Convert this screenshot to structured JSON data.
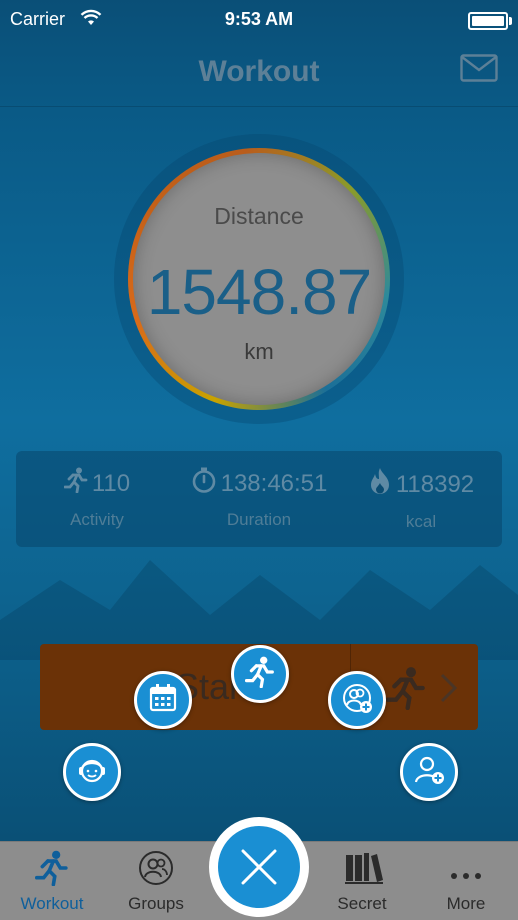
{
  "status_bar": {
    "carrier": "Carrier",
    "time": "9:53 AM"
  },
  "nav": {
    "title": "Workout",
    "mail_icon": "mail-icon"
  },
  "distance": {
    "label": "Distance",
    "value": "1548.87",
    "unit": "km"
  },
  "stats": [
    {
      "icon": "runner-icon",
      "value": "110",
      "label": "Activity"
    },
    {
      "icon": "stopwatch-icon",
      "value": "138:46:51",
      "label": "Duration"
    },
    {
      "icon": "flame-icon",
      "value": "118392",
      "label": "kcal"
    }
  ],
  "start_button": {
    "label": "Start"
  },
  "quick_actions": [
    "support-agent-icon",
    "calendar-icon",
    "run-icon",
    "group-add-icon",
    "user-add-icon"
  ],
  "tabs": [
    {
      "label": "Workout",
      "icon": "runner-icon",
      "active": true
    },
    {
      "label": "Groups",
      "icon": "groups-icon"
    },
    {
      "label": "",
      "icon": "close-icon"
    },
    {
      "label": "Secret",
      "icon": "books-icon"
    },
    {
      "label": "More",
      "icon": "more-dots-icon"
    }
  ],
  "colors": {
    "accent": "#1a8fd3",
    "start_bar": "#6b3207",
    "tab_bar": "#8d8d8d",
    "value_text": "#1a5f88"
  }
}
